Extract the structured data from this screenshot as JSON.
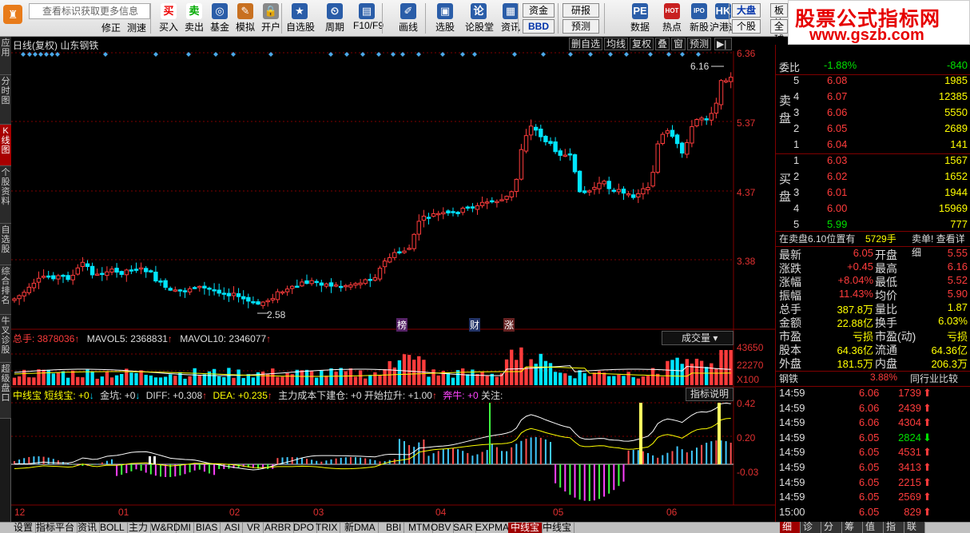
{
  "toolbar": {
    "search_placeholder": "查看标识获取更多信息",
    "buttons": [
      {
        "icon": "买",
        "label": "买入"
      },
      {
        "icon": "卖",
        "label": "卖出"
      },
      {
        "icon": "◎",
        "label": "基金"
      },
      {
        "icon": "✎",
        "label": "模拟"
      },
      {
        "icon": "🔒",
        "label": "开户"
      },
      {
        "icon": "★",
        "label": "自选股"
      },
      {
        "icon": "⏲",
        "label": "周期"
      },
      {
        "icon": "▤",
        "label": "F10/F9"
      },
      {
        "icon": "✐",
        "label": "画线"
      },
      {
        "icon": "▣",
        "label": "选股"
      },
      {
        "icon": "论",
        "label": "论股堂"
      },
      {
        "icon": "▦",
        "label": "资讯"
      },
      {
        "icon": "PE",
        "label": "数据"
      },
      {
        "icon": "HOT",
        "label": "热点"
      },
      {
        "icon": "IPO",
        "label": "新股"
      },
      {
        "icon": "HK",
        "label": "沪港通"
      }
    ],
    "left_small": [
      "修正",
      "测速"
    ],
    "funds": "资金",
    "bbd": "BBD",
    "research": "研报",
    "forecast": "预测",
    "market": "大盘",
    "individual": "个股",
    "board": "板块",
    "all": "全球"
  },
  "brand": {
    "line1": "股票公式指标网",
    "line2": "www.gszb.com"
  },
  "leftbar": [
    "应用",
    "分时图",
    "K线图",
    "个股资料",
    "自选股",
    "综合排名",
    "牛叉诊股",
    "超级盘口"
  ],
  "chart": {
    "title": "日线(复权)  山东钢铁",
    "header_buttons": [
      "删自选",
      "均线",
      "复权",
      "叠",
      "窗",
      "预测"
    ],
    "price_labels": [
      "6.36",
      "5.37",
      "4.37",
      "3.38"
    ],
    "high_label": "6.16",
    "low_label": "2.58",
    "markers": [
      "榜",
      "财",
      "涨"
    ]
  },
  "volume": {
    "total_label": "总手: 3878036",
    "ma5_label": "MAVOL5: 2368831",
    "ma10_label": "MAVOL10: 2346077",
    "dropdown": "成交量",
    "axis": [
      "43650",
      "22270",
      "X100"
    ]
  },
  "indicator": {
    "label_zxb": "中线宝",
    "label_short": "短线宝: +0",
    "label_jk": "金坑: +0",
    "label_diff": "DIFF: +0.308",
    "label_dea": "DEA: +0.235",
    "label_main": "主力成本下建仓: +0 开始拉升: +1.00",
    "label_bull": "奔牛: +0",
    "label_focus": "关注:",
    "help": "指标说明",
    "axis": [
      "0.42",
      "0.20",
      "-0.03"
    ]
  },
  "date_labels": [
    "12",
    "01",
    "02",
    "03",
    "04",
    "05",
    "06"
  ],
  "right": {
    "ratio_label": "委比",
    "ratio_value": "-1.88%",
    "ratio_diff": "-840",
    "sell_label": [
      "卖",
      "盘"
    ],
    "buy_label": [
      "买",
      "盘"
    ],
    "sells": [
      {
        "n": "5",
        "price": "6.08",
        "vol": "1985"
      },
      {
        "n": "4",
        "price": "6.07",
        "vol": "12385"
      },
      {
        "n": "3",
        "price": "6.06",
        "vol": "5550"
      },
      {
        "n": "2",
        "price": "6.05",
        "vol": "2689"
      },
      {
        "n": "1",
        "price": "6.04",
        "vol": "141"
      }
    ],
    "buys": [
      {
        "n": "1",
        "price": "6.03",
        "vol": "1567"
      },
      {
        "n": "2",
        "price": "6.02",
        "vol": "1652"
      },
      {
        "n": "3",
        "price": "6.01",
        "vol": "1944"
      },
      {
        "n": "4",
        "price": "6.00",
        "vol": "15969"
      },
      {
        "n": "5",
        "price": "5.99",
        "vol": "777"
      }
    ],
    "notice_left": "在卖盘6.10位置有",
    "notice_vol": "5729手",
    "notice_right": "卖单! 查看详细",
    "stats": [
      {
        "l1": "最新",
        "v1": "6.05",
        "l2": "开盘",
        "v2": "5.55"
      },
      {
        "l1": "涨跌",
        "v1": "+0.45",
        "l2": "最高",
        "v2": "6.16"
      },
      {
        "l1": "涨幅",
        "v1": "+8.04%",
        "l2": "最低",
        "v2": "5.52"
      },
      {
        "l1": "振幅",
        "v1": "11.43%",
        "l2": "均价",
        "v2": "5.90"
      },
      {
        "l1": "总手",
        "v1": "387.8万",
        "l2": "量比",
        "v2": "1.87"
      },
      {
        "l1": "金额",
        "v1": "22.88亿",
        "l2": "换手",
        "v2": "6.03%"
      },
      {
        "l1": "市盈",
        "v1": "亏损",
        "l2": "市盈(动)",
        "v2": "亏损"
      },
      {
        "l1": "股本",
        "v1": "64.36亿",
        "l2": "流通",
        "v2": "64.36亿"
      },
      {
        "l1": "外盘",
        "v1": "181.5万",
        "l2": "内盘",
        "v2": "206.3万"
      }
    ],
    "industry_name": "钢铁",
    "industry_pct": "3.88%",
    "industry_link": "同行业比较",
    "ticks": [
      {
        "t": "14:59",
        "p": "6.06",
        "v": "1739",
        "d": "up"
      },
      {
        "t": "14:59",
        "p": "6.06",
        "v": "2439",
        "d": "up"
      },
      {
        "t": "14:59",
        "p": "6.06",
        "v": "4304",
        "d": "up"
      },
      {
        "t": "14:59",
        "p": "6.05",
        "v": "2824",
        "d": "down"
      },
      {
        "t": "14:59",
        "p": "6.05",
        "v": "4531",
        "d": "up"
      },
      {
        "t": "14:59",
        "p": "6.05",
        "v": "3413",
        "d": "up"
      },
      {
        "t": "14:59",
        "p": "6.05",
        "v": "2215",
        "d": "up"
      },
      {
        "t": "14:59",
        "p": "6.05",
        "v": "2569",
        "d": "up"
      },
      {
        "t": "15:00",
        "p": "6.05",
        "v": "829",
        "d": "up"
      }
    ]
  },
  "tabs": [
    "设置",
    "指标平台",
    "资讯",
    "BOLL",
    "主力",
    "W&R",
    "DMI",
    "BIAS",
    "ASI",
    "VR",
    "ARBR",
    "DPO",
    "TRIX",
    "新DMA",
    "BBI",
    "MTM",
    "OBV",
    "SAR",
    "EXPMA",
    "中线宝",
    "中线宝"
  ],
  "right_tabs": [
    "细",
    "诊",
    "分",
    "筹",
    "值",
    "指",
    "联"
  ],
  "colors": {
    "up": "#ff3c3c",
    "down": "#00e5ff",
    "ma": "#ffffff",
    "grid": "#800000"
  }
}
